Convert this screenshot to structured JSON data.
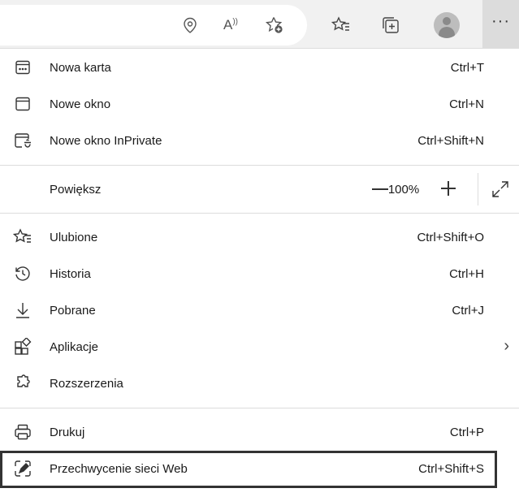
{
  "toolbar": {
    "buttons": [
      {
        "name": "location-icon"
      },
      {
        "name": "read-aloud-icon",
        "label": "A⁾"
      },
      {
        "name": "add-favorite-icon"
      },
      {
        "name": "favorites-icon"
      },
      {
        "name": "collections-icon"
      },
      {
        "name": "profile-avatar"
      }
    ],
    "more_label": "···"
  },
  "menu": {
    "new_tab": {
      "label": "Nowa karta",
      "shortcut": "Ctrl+T"
    },
    "new_window": {
      "label": "Nowe okno",
      "shortcut": "Ctrl+N"
    },
    "new_inprivate": {
      "label": "Nowe okno InPrivate",
      "shortcut": "Ctrl+Shift+N"
    },
    "zoom": {
      "label": "Powiększ",
      "value": "100%"
    },
    "favorites": {
      "label": "Ulubione",
      "shortcut": "Ctrl+Shift+O"
    },
    "history": {
      "label": "Historia",
      "shortcut": "Ctrl+H"
    },
    "downloads": {
      "label": "Pobrane",
      "shortcut": "Ctrl+J"
    },
    "apps": {
      "label": "Aplikacje",
      "arrow": "›"
    },
    "extensions": {
      "label": "Rozszerzenia"
    },
    "print": {
      "label": "Drukuj",
      "shortcut": "Ctrl+P"
    },
    "web_capture": {
      "label": "Przechwycenie sieci Web",
      "shortcut": "Ctrl+Shift+S"
    }
  }
}
